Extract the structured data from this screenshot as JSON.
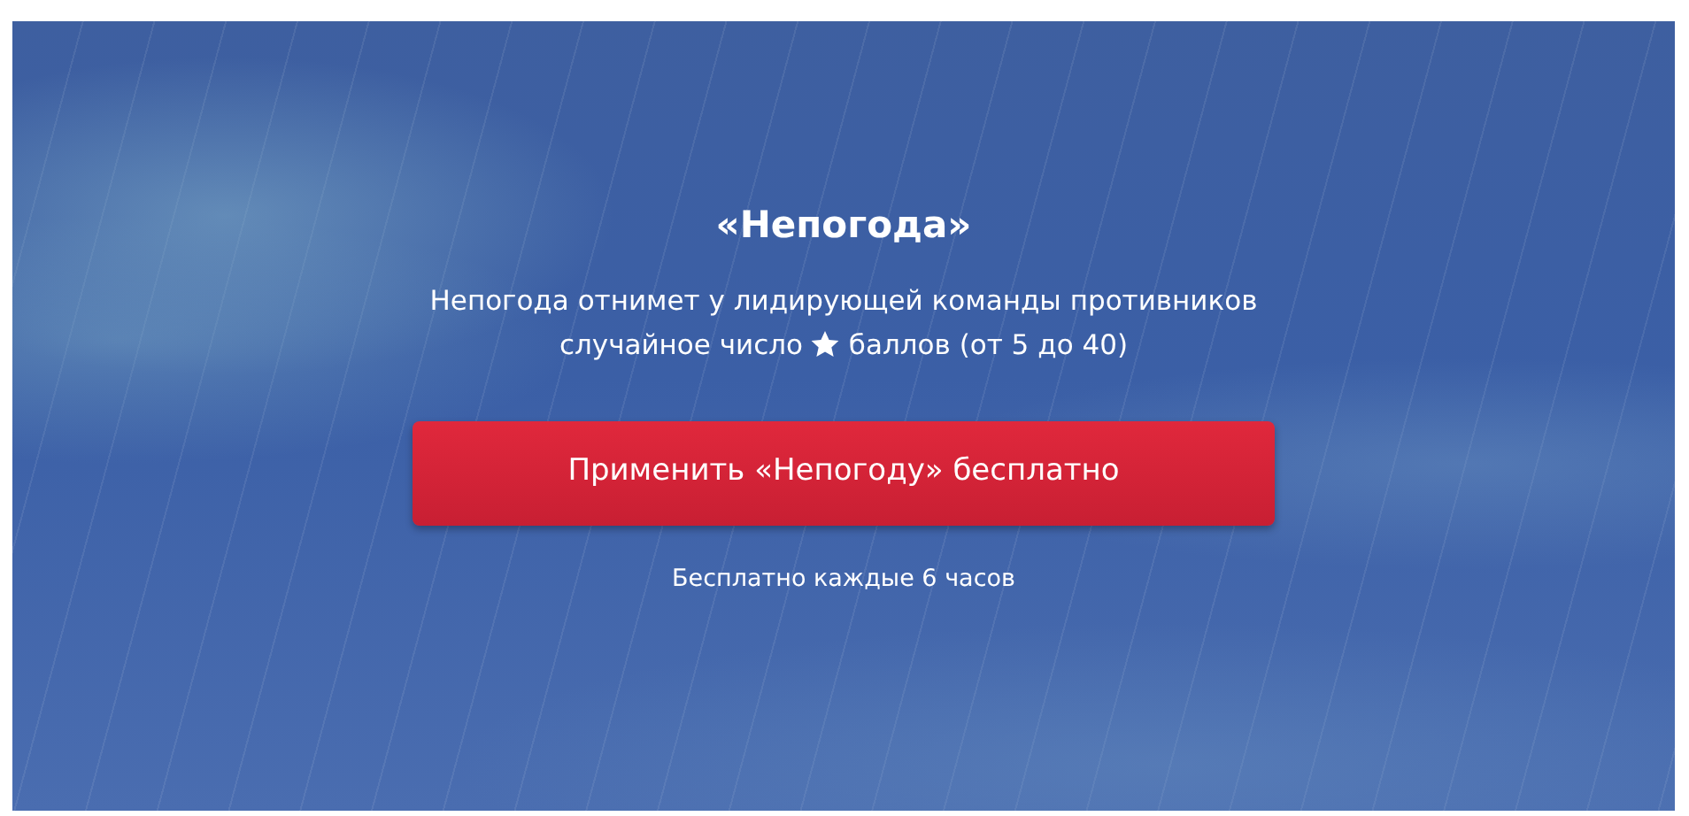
{
  "title": "«Непогода»",
  "description": {
    "line_1": "Непогода отнимет у лидирующей команды противников",
    "line_2_before_star": "случайное число",
    "line_2_after_star": "баллов (от 5 до 40)"
  },
  "button": {
    "label": "Применить «Непогоду» бесплатно"
  },
  "note": "Бесплатно каждые 6 часов"
}
